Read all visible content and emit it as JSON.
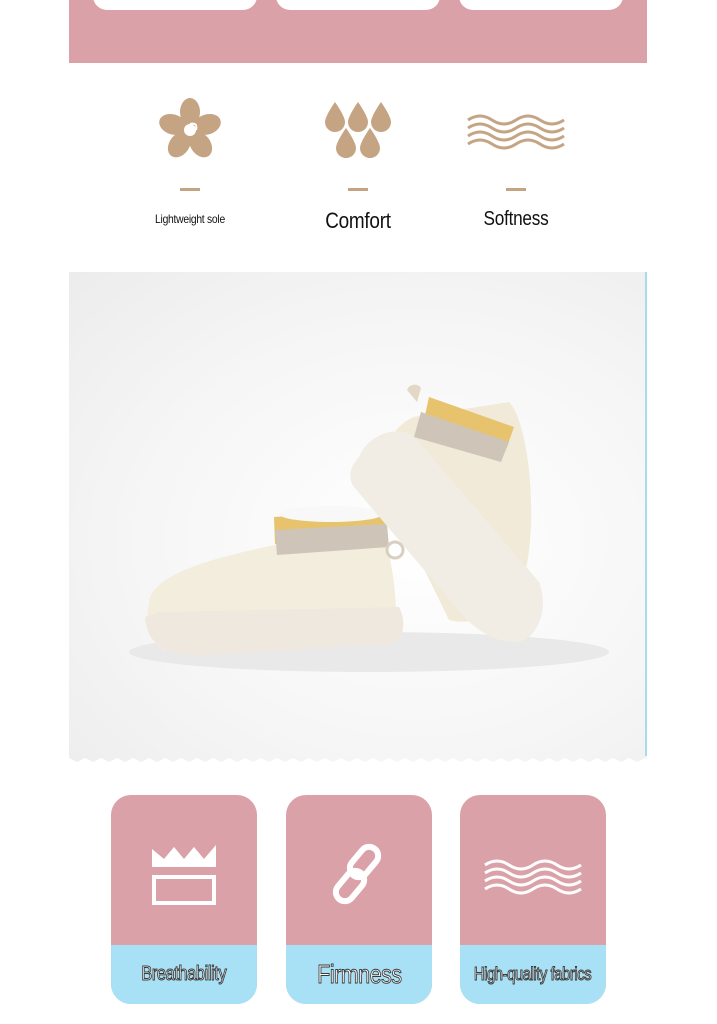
{
  "colors": {
    "band_pink": "#dba1a8",
    "icon_tan": "#c5a483",
    "label_blue": "#a8e0f6",
    "photo_edge_blue": "#a9dbee"
  },
  "features": [
    {
      "icon": "flower-icon",
      "label": "Lightweight sole"
    },
    {
      "icon": "water-drops-icon",
      "label": "Comfort"
    },
    {
      "icon": "waves-icon",
      "label": "Softness"
    }
  ],
  "cards": [
    {
      "icon": "crown-box-icon",
      "label": "Breathability"
    },
    {
      "icon": "chain-link-icon",
      "label": "Firmness"
    },
    {
      "icon": "waves-icon",
      "label": "High-quality fabrics"
    }
  ]
}
